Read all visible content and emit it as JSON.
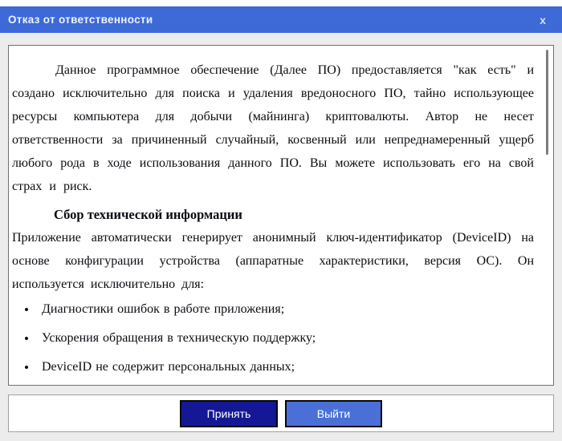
{
  "window": {
    "title": "Отказ от ответственности",
    "close_label": "x"
  },
  "colors": {
    "titlebar_blue": "#3d6ad7",
    "body_gray": "#ececec",
    "accept_button_navy": "#141897",
    "exit_button_blue": "#4a70d8",
    "panel_border": "#6f6f6f"
  },
  "document": {
    "paragraph1": "Данное программное обеспечение (Далее ПО) предоставляется \"как есть\" и создано исключительно для поиска и удаления вредоносного ПО, тайно использующее ресурсы компьютера для добычи (майнинга) криптовалюты. Автор не несет ответственности за причиненный случайный, косвенный или непреднамеренный ущерб любого рода в ходе использования данного ПО. Вы можете использовать его на свой страх и риск.",
    "heading": "Сбор технической информации",
    "paragraph2": "Приложение автоматически генерирует анонимный ключ-идентификатор (DeviceID) на основе конфигурации устройства (аппаратные характеристики, версия ОС). Он используется исключительно для:",
    "bullets": [
      "Диагностики ошибок в работе приложения;",
      "Ускорения обращения в техническую поддержку;",
      "DeviceID не содержит персональных данных;"
    ]
  },
  "buttons": {
    "accept": "Принять",
    "exit": "Выйти"
  }
}
